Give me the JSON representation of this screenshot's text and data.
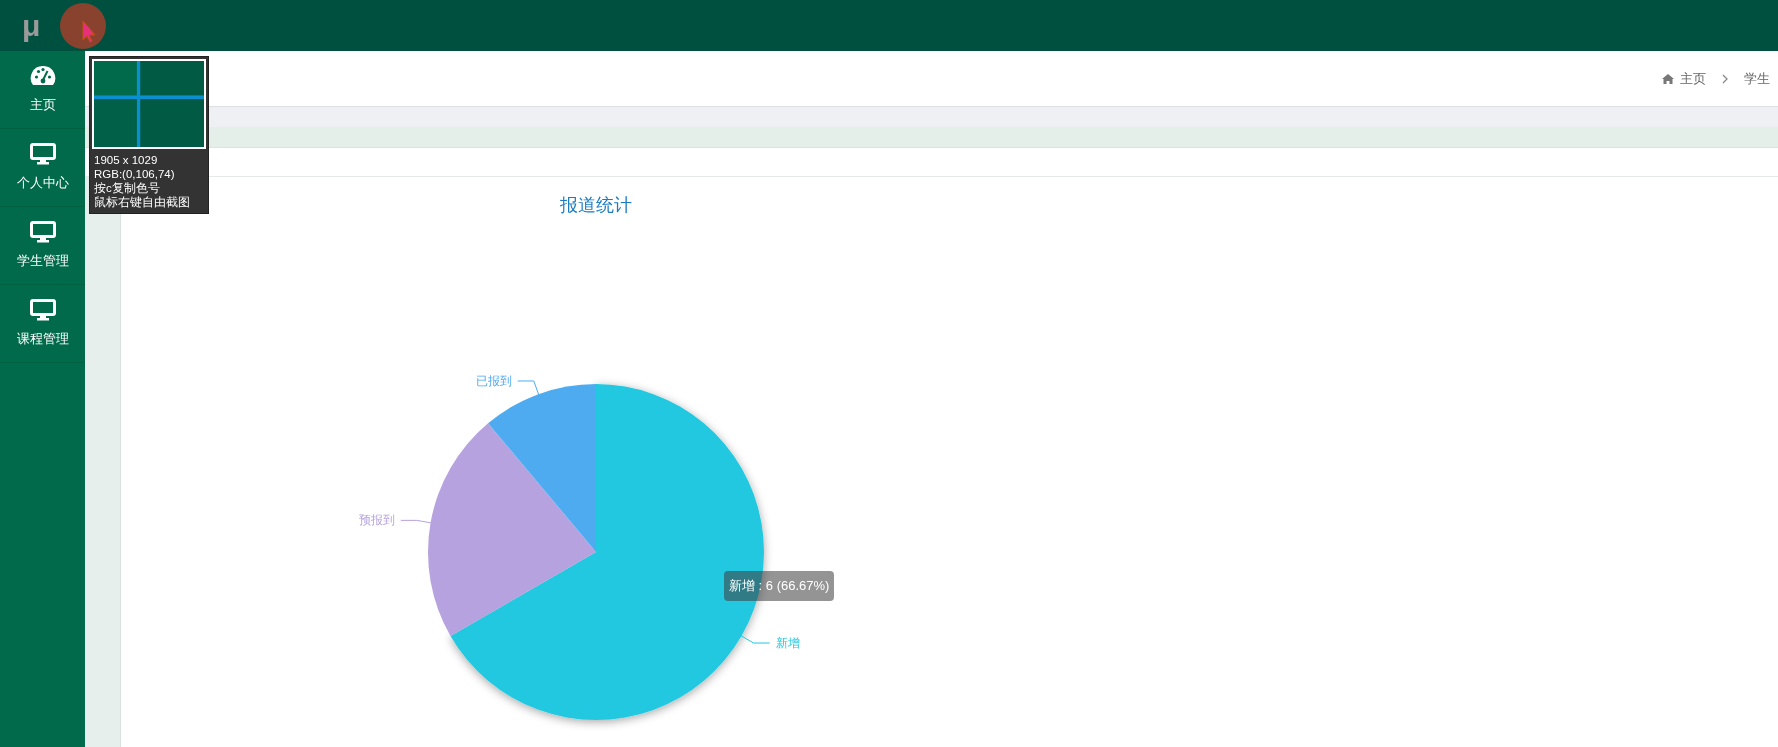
{
  "top_bar": {
    "logo": "μ"
  },
  "sidebar": {
    "items": [
      {
        "label": "主页",
        "kind": "gauge"
      },
      {
        "label": "个人中心",
        "kind": "monitor"
      },
      {
        "label": "学生管理",
        "kind": "monitor"
      },
      {
        "label": "课程管理",
        "kind": "monitor"
      }
    ]
  },
  "breadcrumb": [
    "主页",
    "学生"
  ],
  "chart": {
    "chart_data": {
      "type": "pie",
      "title": "报道统计",
      "categories": [
        "新增",
        "预报到",
        "已报到"
      ],
      "values": [
        66.67,
        22.22,
        11.11
      ],
      "colors": [
        "#22c8df",
        "#b6a2de",
        "#4fabf0"
      ]
    },
    "tooltip": "新增 : 6 (66.67%)"
  },
  "color_picker": {
    "lines": [
      "1905 x 1029",
      "RGB:(0,106,74)",
      "按c复制色号",
      "鼠标右键自由截图"
    ]
  }
}
